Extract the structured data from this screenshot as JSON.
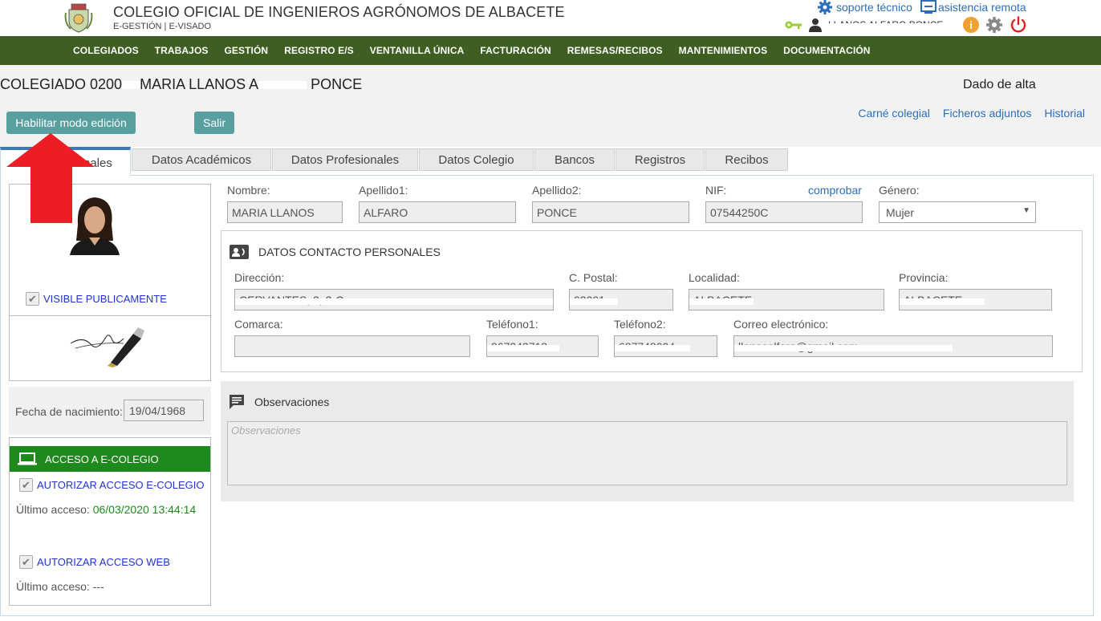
{
  "header": {
    "org_title": "COLEGIO OFICIAL DE INGENIEROS AGRÓNOMOS DE ALBACETE",
    "org_subtitle": "E-GESTIÓN | E-VISADO",
    "support_label": "soporte técnico",
    "remote_label": "asistencia remota",
    "user_name": "LLANOS ALFARO PONCE"
  },
  "nav": {
    "items": [
      "COLEGIADOS",
      "TRABAJOS",
      "GESTIÓN",
      "REGISTRO E/S",
      "VENTANILLA ÚNICA",
      "FACTURACIÓN",
      "REMESAS/RECIBOS",
      "MANTENIMIENTOS",
      "DOCUMENTACIÓN"
    ]
  },
  "page": {
    "title_prefix": "COLEGIADO 0200",
    "title_mid": "MARIA LLANOS A",
    "title_end": "PONCE",
    "top_right": "Dado de alta"
  },
  "actions": {
    "edit_label": "Habilitar modo edición",
    "exit_label": "Salir",
    "links": [
      "Carné colegial",
      "Ficheros adjuntos",
      "Historial"
    ]
  },
  "tabs": [
    "Datos personales",
    "Datos Académicos",
    "Datos Profesionales",
    "Datos Colegio",
    "Bancos",
    "Registros",
    "Recibos"
  ],
  "left": {
    "visible_label": "VISIBLE PUBLICAMENTE",
    "birth_label": "Fecha de nacimiento:",
    "birth_value": "19/04/1968",
    "access_title": "ACCESO A E-COLEGIO",
    "access_ecolegio_label": "AUTORIZAR ACCESO E-COLEGIO",
    "last_access_label": "Último acceso:",
    "last_access_ecolegio": "06/03/2020 13:44:14",
    "access_web_label": "AUTORIZAR ACCESO WEB",
    "last_access_web": "---"
  },
  "personal": {
    "nombre_label": "Nombre:",
    "nombre": "MARIA LLANOS",
    "apellido1_label": "Apellido1:",
    "apellido1": "ALFARO",
    "apellido2_label": "Apellido2:",
    "apellido2": "PONCE",
    "nif_label": "NIF:",
    "nif": "07544250C",
    "comprobar": "comprobar",
    "genero_label": "Género:",
    "genero": "Mujer"
  },
  "contact": {
    "title": "DATOS CONTACTO PERSONALES",
    "direccion_label": "Dirección:",
    "direccion": "CERVANTES, 2, 2-C",
    "cpostal_label": "C. Postal:",
    "cpostal": "02001",
    "localidad_label": "Localidad:",
    "localidad": "ALBACETE",
    "provincia_label": "Provincia:",
    "provincia": "ALBACETE",
    "comarca_label": "Comarca:",
    "comarca": "",
    "telefono1_label": "Teléfono1:",
    "telefono1": "967242718",
    "telefono2_label": "Teléfono2:",
    "telefono2": "687748004",
    "correo_label": "Correo electrónico:",
    "correo": "llanosalfaro@gmail.com"
  },
  "observaciones": {
    "title": "Observaciones",
    "placeholder": "Observaciones"
  },
  "colors": {
    "nav_bg": "#3e5e22",
    "button_bg": "#5a9fa0",
    "access_green": "#1e8a1e",
    "link_blue": "#2a6ebb",
    "arrow_red": "#ee1c24"
  }
}
